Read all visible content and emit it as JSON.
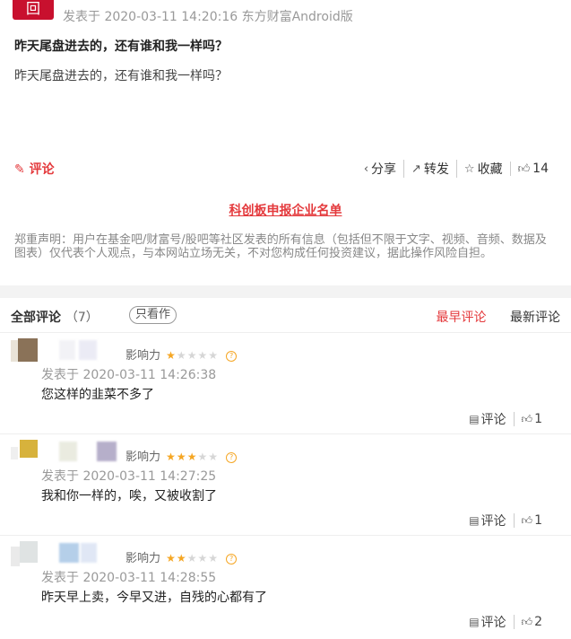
{
  "post": {
    "avatar_icon": "brand-logo-icon",
    "meta": "发表于 2020-03-11 14:20:16 东方财富Android版",
    "title": "昨天尾盘进去的，还有谁和我一样吗？",
    "body": "昨天尾盘进去的，还有谁和我一样吗？",
    "comment_label": "评论",
    "share_label": "分享",
    "forward_label": "转发",
    "favorite_label": "收藏",
    "like_count": "14",
    "promo_link": "科创板申报企业名单",
    "disclaimer": "郑重声明：用户在基金吧/财富号/股吧等社区发表的所有信息（包括但不限于文字、视频、音频、数据及图表）仅代表个人观点，与本网站立场无关，不对您构成任何投资建议，据此操作风险自担。"
  },
  "comments_section": {
    "title": "全部评论",
    "count": "（7）",
    "only_author": "只看作",
    "sort_earliest": "最早评论",
    "sort_latest": "最新评论",
    "items": [
      {
        "influence_label": "影响力",
        "stars": 1,
        "time": "发表于 2020-03-11 14:26:38",
        "text": "您这样的韭菜不多了",
        "comment_label": "评论",
        "likes": "1"
      },
      {
        "influence_label": "影响力",
        "stars": 2.5,
        "time": "发表于 2020-03-11 14:27:25",
        "text": "我和你一样的，唉，又被收割了",
        "comment_label": "评论",
        "likes": "1"
      },
      {
        "influence_label": "影响力",
        "stars": 2,
        "time": "发表于 2020-03-11 14:28:55",
        "text": "昨天早上卖，今早又进，自残的心都有了",
        "comment_label": "评论",
        "likes": "2"
      }
    ]
  },
  "colors": {
    "accent": "#e4393c",
    "star": "#f5a623",
    "muted": "#999999"
  }
}
